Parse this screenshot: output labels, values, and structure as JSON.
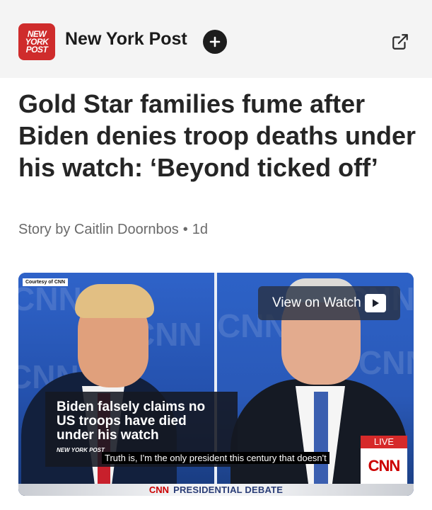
{
  "header": {
    "logo_text": [
      "NEW",
      "YORK",
      "POST"
    ],
    "publisher": "New York Post",
    "follow_icon": "plus-icon",
    "external_icon": "external-link-icon"
  },
  "article": {
    "headline": "Gold Star families fume after Biden denies troop deaths under his watch: ‘Beyond ticked off’",
    "byline": "Story by Caitlin Doornbos",
    "separator": "•",
    "age": "1d"
  },
  "video": {
    "courtesy": "Courtesy of CNN",
    "view_on_watch": "View on Watch",
    "play_icon": "play-icon",
    "chyron": "Biden falsely claims no US troops have died under his watch",
    "chyron_tag": "NEW YORK POST",
    "caption": "Truth is, I'm the only president this century that doesn't",
    "live": "LIVE",
    "cnn": "CNN",
    "bottom_brand": "CNN",
    "bottom_title": "PRESIDENTIAL DEBATE",
    "background_marks": [
      "CNN",
      "CNN",
      "CNN",
      "CNN",
      "CNN",
      "CNN"
    ]
  },
  "colors": {
    "nypost_red": "#cf2c2c",
    "header_bg": "#f4f4f4",
    "cnn_red": "#cc0000",
    "studio_blue": "#2a59b8"
  }
}
